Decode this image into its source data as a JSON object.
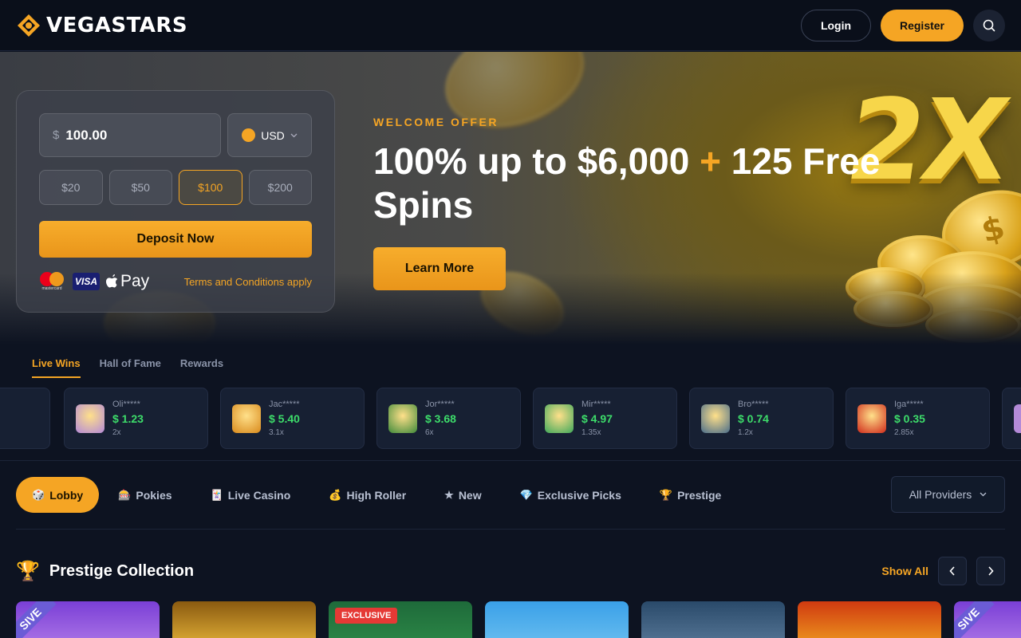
{
  "header": {
    "brand": "VEGASTARS",
    "login_label": "Login",
    "register_label": "Register",
    "accent_color": "#f5a524"
  },
  "deposit": {
    "currency_symbol": "$",
    "amount_value": "100.00",
    "currency": "USD",
    "presets": [
      "$20",
      "$50",
      "$100",
      "$200"
    ],
    "selected_preset": "$100",
    "deposit_label": "Deposit Now",
    "mastercard_text": "mastercard",
    "visa_text": "VISA",
    "applepay_text": "Pay",
    "terms_label": "Terms and Conditions apply"
  },
  "hero": {
    "eyebrow": "WELCOME OFFER",
    "headline_part1": "100% up to $6,000",
    "headline_plus": "+",
    "headline_part2": "125 Free Spins",
    "cta_label": "Learn More",
    "badge_text": "2X"
  },
  "wins": {
    "tabs": [
      "Live Wins",
      "Hall of Fame",
      "Rewards"
    ],
    "active_tab": "Live Wins",
    "items": [
      {
        "user": "Oli*****",
        "amount": "$ 1.23",
        "mult": "2x",
        "thumb": "#b48ad8"
      },
      {
        "user": "Jac*****",
        "amount": "$ 5.40",
        "mult": "3.1x",
        "thumb": "#d98a1c"
      },
      {
        "user": "Jor*****",
        "amount": "$ 3.68",
        "mult": "6x",
        "thumb": "#3f8a3a"
      },
      {
        "user": "Mir*****",
        "amount": "$ 4.97",
        "mult": "1.35x",
        "thumb": "#3fa85a"
      },
      {
        "user": "Bro*****",
        "amount": "$ 0.74",
        "mult": "1.2x",
        "thumb": "#4a6d8a"
      },
      {
        "user": "Iga*****",
        "amount": "$ 0.35",
        "mult": "2.85x",
        "thumb": "#d02a1a"
      }
    ]
  },
  "categories": {
    "items": [
      {
        "icon": "🎲",
        "label": "Lobby"
      },
      {
        "icon": "🎰",
        "label": "Pokies"
      },
      {
        "icon": "🃏",
        "label": "Live Casino"
      },
      {
        "icon": "💰",
        "label": "High Roller"
      },
      {
        "icon": "★",
        "label": "New"
      },
      {
        "icon": "💎",
        "label": "Exclusive Picks"
      },
      {
        "icon": "🏆",
        "label": "Prestige"
      }
    ],
    "active": "Lobby",
    "providers_label": "All Providers"
  },
  "section": {
    "icon": "🏆",
    "title": "Prestige Collection",
    "show_all_label": "Show All",
    "exclusive_badge": "EXCLUSIVE",
    "ribbon_text": "SIVE",
    "games": [
      {
        "bg": "linear-gradient(180deg,#7a3fd6,#b07ae8)",
        "ribbon": true
      },
      {
        "bg": "linear-gradient(180deg,#8a5a10,#e8b63a)",
        "ribbon": false
      },
      {
        "bg": "linear-gradient(180deg,#1e6a3a,#2d8a48)",
        "badge": true
      },
      {
        "bg": "linear-gradient(180deg,#3aa0e8,#6cc0f0)",
        "ribbon": false
      },
      {
        "bg": "linear-gradient(180deg,#2a4a6a,#5a7a9a)",
        "ribbon": false
      },
      {
        "bg": "linear-gradient(180deg,#d03a10,#f0a020)",
        "ribbon": false
      },
      {
        "bg": "linear-gradient(180deg,#7a3fd6,#b07ae8)",
        "ribbon": true
      }
    ]
  }
}
